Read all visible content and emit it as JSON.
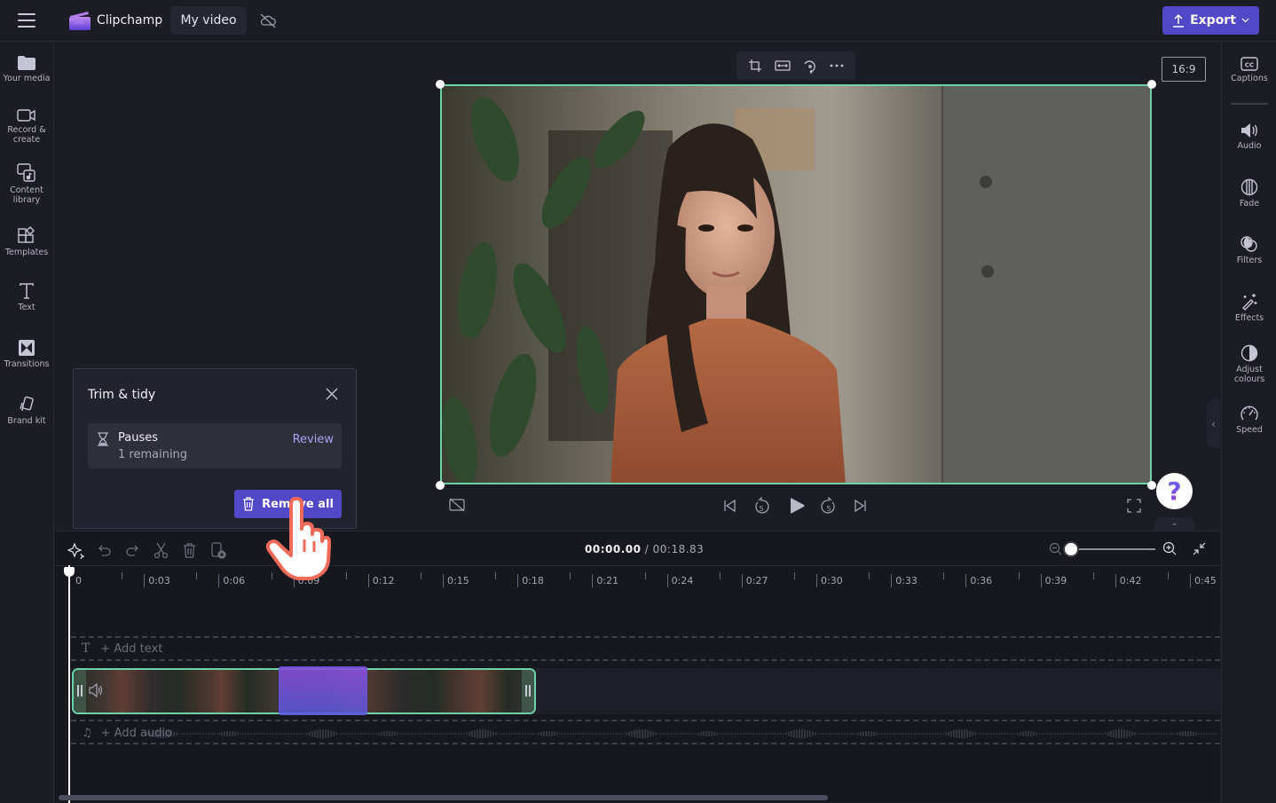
{
  "topbar": {
    "brand": "Clipchamp",
    "project_title": "My video",
    "export_label": "Export",
    "menu_icon": "hamburger-icon",
    "sync_icon": "cloud-offline-icon"
  },
  "left_sidebar": {
    "items": [
      {
        "label": "Your media",
        "icon": "folder-icon"
      },
      {
        "label": "Record &",
        "label2": "create",
        "icon": "camera-icon"
      },
      {
        "label": "Content",
        "label2": "library",
        "icon": "content-library-icon"
      },
      {
        "label": "Templates",
        "icon": "templates-icon"
      },
      {
        "label": "Text",
        "icon": "text-icon"
      },
      {
        "label": "Transitions",
        "icon": "transitions-icon"
      },
      {
        "label": "Brand kit",
        "icon": "brand-kit-icon"
      }
    ]
  },
  "right_sidebar": {
    "items": [
      {
        "label": "Captions",
        "icon": "captions-icon"
      },
      {
        "label": "Audio",
        "icon": "speaker-icon"
      },
      {
        "label": "Fade",
        "icon": "fade-icon"
      },
      {
        "label": "Filters",
        "icon": "filters-icon"
      },
      {
        "label": "Effects",
        "icon": "magic-wand-icon"
      },
      {
        "label": "Adjust",
        "label2": "colours",
        "icon": "adjust-colours-icon"
      },
      {
        "label": "Speed",
        "icon": "speedometer-icon"
      }
    ]
  },
  "preview": {
    "aspect_ratio": "16:9",
    "toolbar_icons": [
      "crop-icon",
      "fit-icon",
      "rotate-icon",
      "more-icon"
    ],
    "controls": [
      "captions-off-icon",
      "skip-back-icon",
      "rewind-5-icon",
      "play-icon",
      "forward-5-icon",
      "skip-forward-icon",
      "fullscreen-icon"
    ],
    "rewind_seconds": "5",
    "forward_seconds": "5",
    "help_label": "?"
  },
  "trim_panel": {
    "title": "Trim & tidy",
    "item_title": "Pauses",
    "item_subtitle": "1 remaining",
    "review_label": "Review",
    "remove_all_label": "Remove all"
  },
  "timeline": {
    "current_time": "00:00.00",
    "separator": " / ",
    "total_time": "00:18.83",
    "zoom_level": 0.0,
    "ticks": [
      "0",
      "0:03",
      "0:06",
      "0:09",
      "0:12",
      "0:15",
      "0:18",
      "0:21",
      "0:24",
      "0:27",
      "0:30",
      "0:33",
      "0:36",
      "0:39",
      "0:42",
      "0:45"
    ],
    "add_text_label": "+ Add text",
    "add_audio_label": "+ Add audio",
    "colors": {
      "accent": "#5148c8",
      "selection_border": "#6fd1a8",
      "highlight_segment": "#7a52e0"
    }
  }
}
